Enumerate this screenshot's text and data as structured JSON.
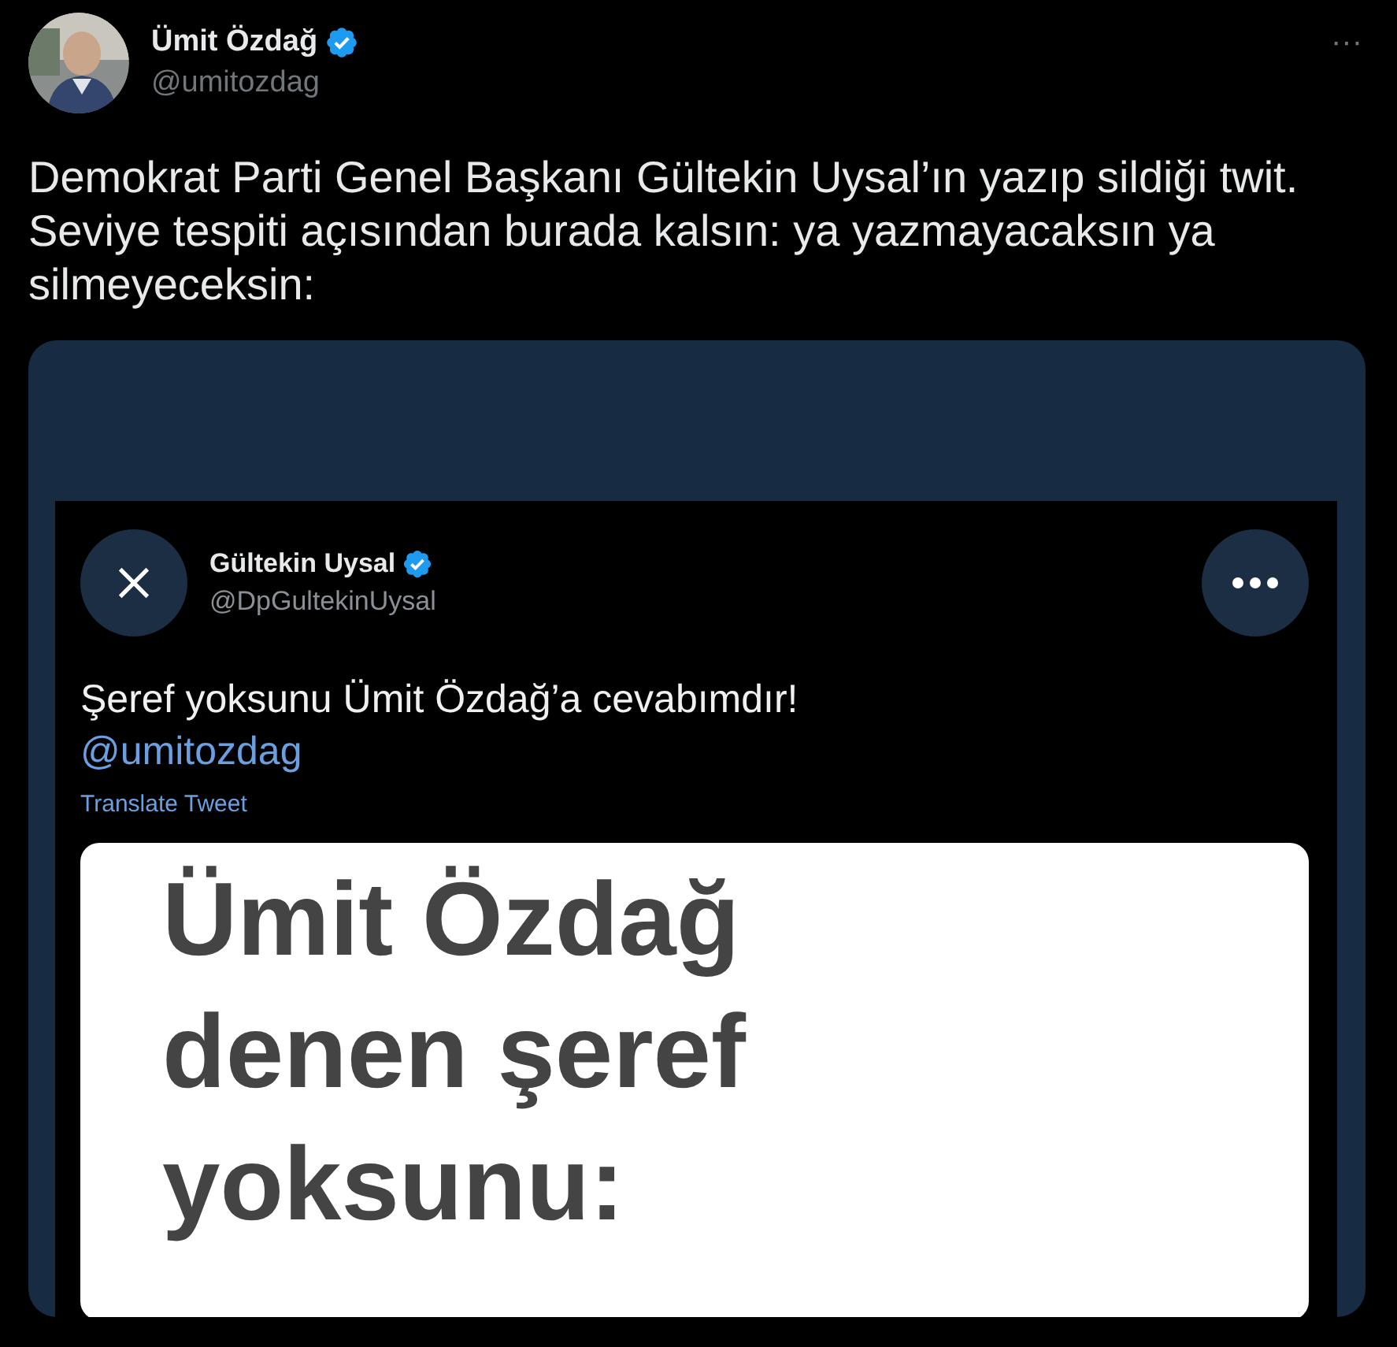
{
  "author": {
    "name": "Ümit Özdağ",
    "handle": "@umitozdag",
    "verified": true
  },
  "more": "···",
  "text": "Demokrat Parti Genel Başkanı Gültekin Uysal’ın yazıp sildiği twit. Seviye tespiti açısından burada kalsın: ya yazmayacaksın ya silmeyeceksin:",
  "embedded_screenshot": {
    "author": {
      "name": "Gültekin Uysal",
      "handle": "@DpGultekinUysal",
      "verified": true
    },
    "text": "Şeref yoksunu Ümit Özdağ’a cevabımdır!",
    "mention": "@umitozdag",
    "translate": "Translate Tweet",
    "image_lines": [
      "Ümit Özdağ",
      "denen şeref",
      "yoksunu:"
    ]
  }
}
